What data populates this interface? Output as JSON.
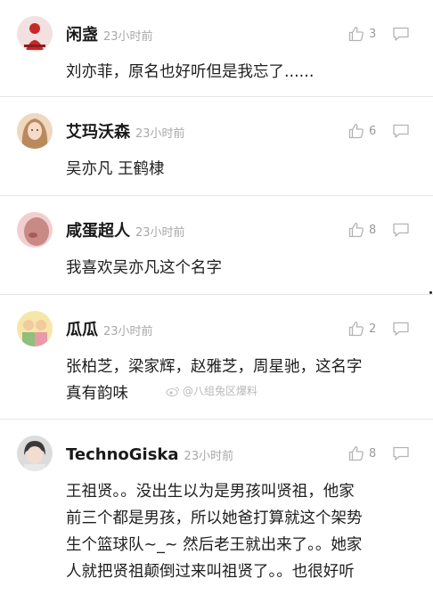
{
  "comments": [
    {
      "name": "闲盏",
      "time": "23小时前",
      "likes": "3",
      "text": "刘亦菲，原名也好听但是我忘了......",
      "avatar_colors": [
        "#c62828",
        "#f3e0e0"
      ]
    },
    {
      "name": "艾玛沃森",
      "time": "23小时前",
      "likes": "6",
      "text": "吴亦凡 王鹤棣",
      "avatar_colors": [
        "#b98a5e",
        "#f0d8c0"
      ]
    },
    {
      "name": "咸蛋超人",
      "time": "23小时前",
      "likes": "8",
      "text": "我喜欢吴亦凡这个名字",
      "avatar_colors": [
        "#c98a86",
        "#f2cfcf"
      ]
    },
    {
      "name": "瓜瓜",
      "time": "23小时前",
      "likes": "2",
      "text": "张柏芝，梁家辉，赵雅芝，周星驰，这名字\n真有韵味",
      "avatar_colors": [
        "#8fbf7a",
        "#f6e7a8"
      ]
    },
    {
      "name": "TechnoGiska",
      "time": "23小时前",
      "likes": "8",
      "text": "王祖贤。。没出生以为是男孩叫贤祖，他家\n前三个都是男孩，所以她爸打算就这个架势\n生个篮球队~_~ 然后老王就出来了。。她家\n人就把贤祖颠倒过来叫祖贤了。。也很好听",
      "avatar_colors": [
        "#3a3a3a",
        "#dcdcdc"
      ]
    }
  ],
  "watermark": {
    "text": "@八组兔区爆料"
  },
  "icon_colors": {
    "action": "#b3b3b3",
    "watermark": "#c4c4c4"
  }
}
